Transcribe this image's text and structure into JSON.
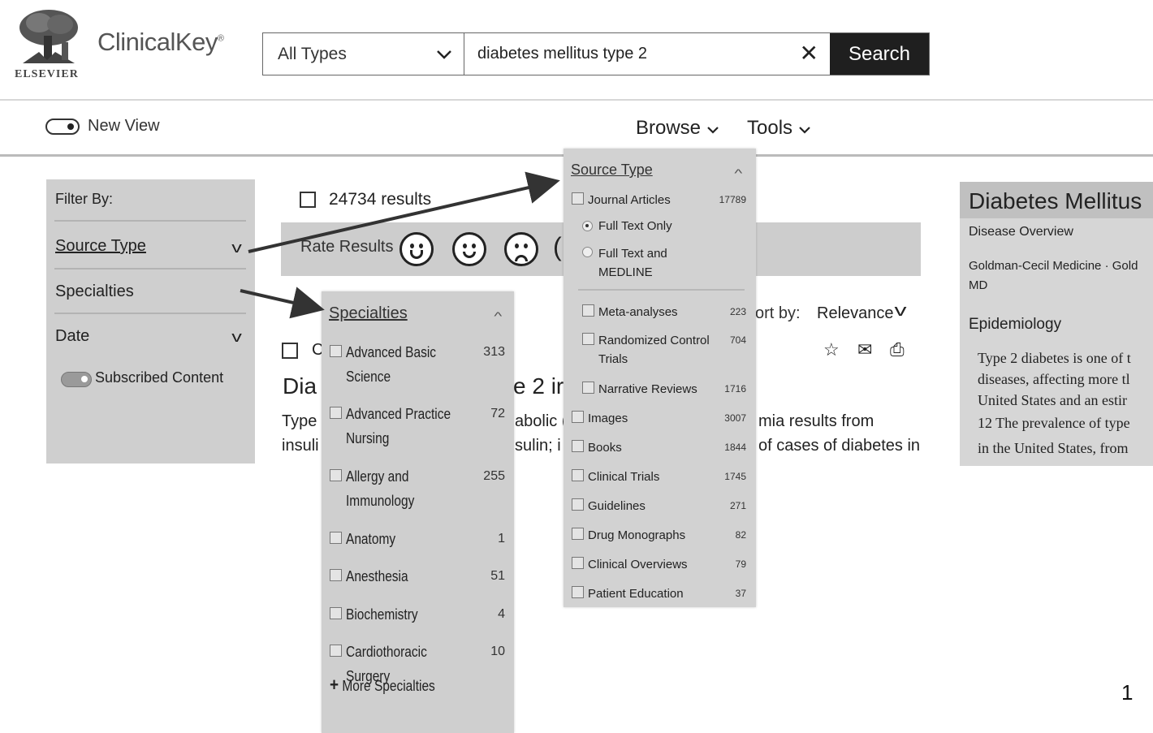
{
  "header": {
    "brand": "ClinicalKey",
    "brand_mark": "®",
    "logo_text": "ELSEVIER",
    "type_select": "All Types",
    "search_query": "diabetes mellitus type 2",
    "search_button": "Search",
    "new_view": "New View",
    "browse": "Browse",
    "tools": "Tools"
  },
  "filter": {
    "heading": "Filter By:",
    "items": [
      "Source Type",
      "Specialties",
      "Date"
    ],
    "subscribed": "Subscribed Content"
  },
  "results": {
    "count": "24734 results",
    "rate_label": "Rate Results",
    "sort_label": "ort by:",
    "sort_value": "Relevance",
    "select_letter": "C",
    "title_left": "Dia",
    "title_right": "e 2 ir",
    "snippet_left_1": "Type",
    "snippet_left_2": "insuli",
    "snippet_mid_1": "abolic (",
    "snippet_mid_2": "sulin; i",
    "snippet_right_1": "mia results from",
    "snippet_right_2": "of cases of diabetes in"
  },
  "specialties_panel": {
    "title": "Specialties",
    "items": [
      {
        "label": "Advanced Basic Science",
        "count": "313"
      },
      {
        "label": "Advanced Practice Nursing",
        "count": "72"
      },
      {
        "label": "Allergy and Immunology",
        "count": "255"
      },
      {
        "label": "Anatomy",
        "count": "1"
      },
      {
        "label": "Anesthesia",
        "count": "51"
      },
      {
        "label": "Biochemistry",
        "count": "4"
      },
      {
        "label": "Cardiothoracic Surgery",
        "count": "10"
      }
    ],
    "more": "More Specialties"
  },
  "source_panel": {
    "title": "Source Type",
    "journal": {
      "label": "Journal Articles",
      "count": "17789"
    },
    "radio_1": "Full Text Only",
    "radio_2": "Full Text and MEDLINE",
    "sub_items": [
      {
        "label": "Meta-analyses",
        "count": "223"
      },
      {
        "label": "Randomized Control Trials",
        "count": "704"
      },
      {
        "label": "Narrative Reviews",
        "count": "1716"
      }
    ],
    "items": [
      {
        "label": "Images",
        "count": "3007"
      },
      {
        "label": "Books",
        "count": "1844"
      },
      {
        "label": "Clinical Trials",
        "count": "1745"
      },
      {
        "label": "Guidelines",
        "count": "271"
      },
      {
        "label": "Drug Monographs",
        "count": "82"
      },
      {
        "label": "Clinical Overviews",
        "count": "79"
      },
      {
        "label": "Patient Education",
        "count": "37"
      }
    ]
  },
  "right_panel": {
    "title": "Diabetes Mellitus",
    "subtitle": "Disease Overview",
    "source_1": "Goldman-Cecil Medicine · Gold",
    "source_2": "MD",
    "section": "Epidemiology",
    "lines": [
      "Type 2 diabetes is one of t",
      "diseases, affecting more tl",
      "United States and an estir",
      "12 The prevalence of type",
      "in the United States, from"
    ]
  },
  "slide_number": "1"
}
